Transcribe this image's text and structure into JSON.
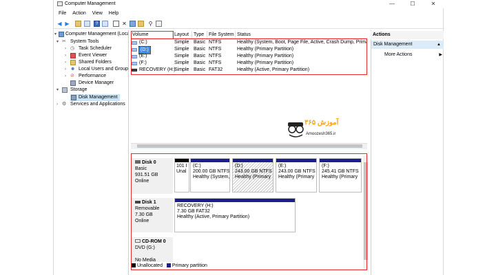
{
  "window": {
    "title": "Computer Management",
    "min": "—",
    "max": "☐",
    "close": "✕"
  },
  "menu": [
    "File",
    "Action",
    "View",
    "Help"
  ],
  "tree": {
    "root": "Computer Management (Local",
    "system_tools": "System Tools",
    "task_scheduler": "Task Scheduler",
    "event_viewer": "Event Viewer",
    "shared_folders": "Shared Folders",
    "local_users": "Local Users and Groups",
    "performance": "Performance",
    "device_manager": "Device Manager",
    "storage": "Storage",
    "disk_management": "Disk Management",
    "services": "Services and Applications"
  },
  "columns": [
    "Volume",
    "Layout",
    "Type",
    "File System",
    "Status"
  ],
  "volumes": [
    {
      "name": "(C:)",
      "layout": "Simple",
      "type": "Basic",
      "fs": "NTFS",
      "status": "Healthy (System, Boot, Page File, Active, Crash Dump, Primar"
    },
    {
      "name": "(D:)",
      "layout": "Simple",
      "type": "Basic",
      "fs": "NTFS",
      "status": "Healthy (Primary Partition)"
    },
    {
      "name": "(E:)",
      "layout": "Simple",
      "type": "Basic",
      "fs": "NTFS",
      "status": "Healthy (Primary Partition)"
    },
    {
      "name": "(F:)",
      "layout": "Simple",
      "type": "Basic",
      "fs": "NTFS",
      "status": "Healthy (Primary Partition)"
    },
    {
      "name": "RECOVERY (H:)",
      "layout": "Simple",
      "type": "Basic",
      "fs": "FAT32",
      "status": "Healthy (Active, Primary Partition)"
    }
  ],
  "disk0": {
    "name": "Disk 0",
    "type": "Basic",
    "size": "931.51 GB",
    "state": "Online",
    "parts": [
      {
        "l1": "",
        "l2": "101 I",
        "l3": "Unal"
      },
      {
        "l1": "(C:)",
        "l2": "200.00 GB NTFS",
        "l3": "Healthy (System,"
      },
      {
        "l1": "(D:)",
        "l2": "243.00 GB NTFS",
        "l3": "Healthy (Primary"
      },
      {
        "l1": "(E:)",
        "l2": "243.00 GB NTFS",
        "l3": "Healthy (Primary"
      },
      {
        "l1": "(F:)",
        "l2": "245.41 GB NTFS",
        "l3": "Healthy (Primary"
      }
    ]
  },
  "disk1": {
    "name": "Disk 1",
    "type": "Removable",
    "size": "7.30 GB",
    "state": "Online",
    "part": {
      "l1": "RECOVERY  (H:)",
      "l2": "7.30 GB FAT32",
      "l3": "Healthy (Active, Primary Partition)"
    }
  },
  "cdrom": {
    "name": "CD-ROM 0",
    "drive": "DVD (G:)",
    "media": "No Media"
  },
  "legend": {
    "unallocated": "Unallocated",
    "primary": "Primary partition"
  },
  "actions": {
    "header": "Actions",
    "disk_management": "Disk Management",
    "more": "More Actions"
  },
  "watermark": {
    "brand": "آموزش ۳۶۵",
    "site": "Amoozesh365.ir"
  },
  "colors": {
    "primary": "#1c1c8c",
    "unallocated": "#000000",
    "highlight": "#e52b2b",
    "watermark": "#f7a21b"
  }
}
